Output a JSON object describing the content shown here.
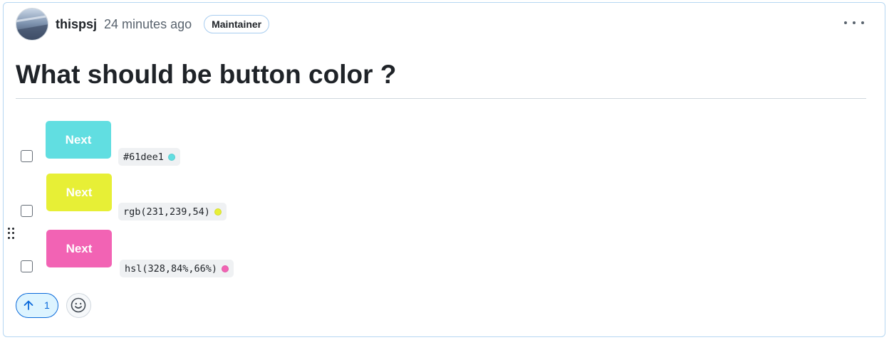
{
  "post": {
    "author": "thispsj",
    "time": "24 minutes ago",
    "role_badge": "Maintainer",
    "title": "What should be button color ?",
    "options": [
      {
        "button_label": "Next",
        "color_code": "#61dee1",
        "color": "#61dee1"
      },
      {
        "button_label": "Next",
        "color_code": "rgb(231,239,54)",
        "color": "#e7ef36"
      },
      {
        "button_label": "Next",
        "color_code": "hsl(328,84%,66%)",
        "color": "#f263b4"
      }
    ]
  },
  "reactions": {
    "upvote_count": "1"
  },
  "icons": {
    "more": "kebab-horizontal-icon",
    "upvote": "arrow-up-icon",
    "emoji": "smiley-icon",
    "drag": "grabber-icon"
  },
  "colors": {
    "accent": "#0969da",
    "border": "#b6d7f2"
  }
}
